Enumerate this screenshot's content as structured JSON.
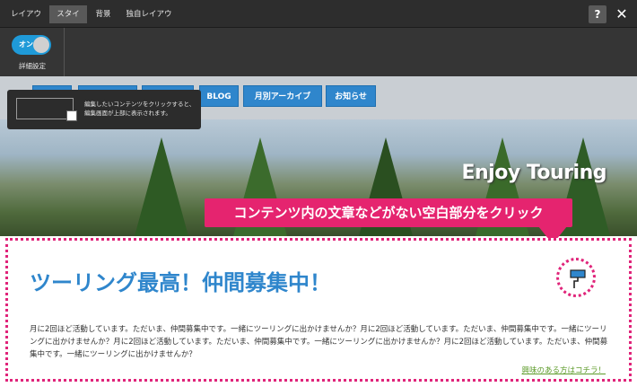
{
  "topbar": {
    "tabs": [
      {
        "label": "レイアウト",
        "active": false
      },
      {
        "label": "スタイル",
        "active": true
      },
      {
        "label": "背景",
        "active": false
      },
      {
        "label": "独自レイアウト",
        "active": false
      }
    ],
    "help_label": "?",
    "close_label": "✕"
  },
  "toolbar": {
    "toggle_label": "オン",
    "detail_label": "詳細設定"
  },
  "tooltip": {
    "text": "編集したいコンテンツをクリックすると、編集画面が上部に表示されます。"
  },
  "nav": {
    "items": [
      "BLOG",
      "月別アーカイブ",
      "お知らせ"
    ]
  },
  "hero": {
    "title": "Enjoy Touring"
  },
  "callout": {
    "text": "コンテンツ内の文章などがない空白部分をクリック"
  },
  "article": {
    "title": "ツーリング最高！仲間募集中！",
    "body": "月に2回ほど活動しています。ただいま、仲間募集中です。一緒にツーリングに出かけませんか？月に2回ほど活動しています。ただいま、仲間募集中です。一緒にツーリングに出かけませんか？月に2回ほど活動しています。ただいま、仲間募集中です。一緒にツーリングに出かけませんか？月に2回ほど活動しています。ただいま、仲間募集中です。一緒にツーリングに出かけませんか？",
    "link": "興味のある方はコチラ！"
  },
  "colors": {
    "accent_blue": "#2f86cc",
    "callout_pink": "#e5246f",
    "link_green": "#5d9b2a",
    "toolbar_dark": "#2d2d2d"
  },
  "icons": [
    "help-icon",
    "close-icon",
    "paint-roller-icon"
  ]
}
